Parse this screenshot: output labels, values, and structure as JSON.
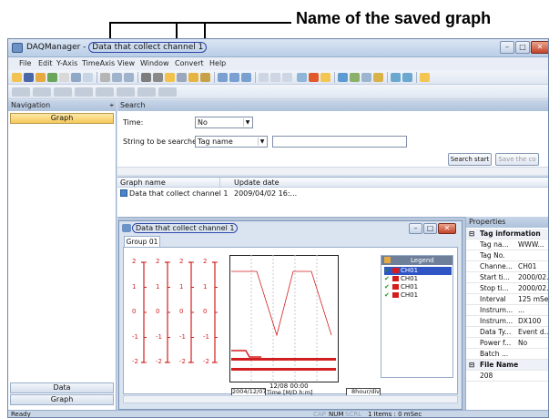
{
  "callout": {
    "saved_graph_label": "Name of the saved graph"
  },
  "window": {
    "app_name": "DAQManager",
    "title_sep": " - ",
    "doc_title": "Data that collect channel 1",
    "controls": {
      "minimize": "–",
      "maximize": "□",
      "close": "✕"
    }
  },
  "menu": [
    "File",
    "Edit",
    "Y-Axis",
    "TimeAxis",
    "View",
    "Window",
    "Convert",
    "Help"
  ],
  "nav": {
    "header": "Navigation",
    "pin": "⌖",
    "selected_item": "Graph",
    "bottom_tabs": [
      "Data",
      "Graph"
    ]
  },
  "search": {
    "header": "Search",
    "time_label": "Time:",
    "time_value": "No",
    "string_label": "String to be searched:",
    "string_field": "Tag name",
    "text_value": "",
    "start_button": "Search start",
    "save_button": "Save the co"
  },
  "results": {
    "columns": [
      "Graph name",
      "Update date"
    ],
    "rows": [
      {
        "name": "Data that collect channel 1",
        "date": "2009/04/02 16:..."
      }
    ]
  },
  "graph_window": {
    "title": "Data that collect channel 1",
    "tab": "Group 01",
    "scale_values": [
      "2",
      "1",
      "0",
      "-1",
      "-2"
    ],
    "time_label": "12/08 00:00",
    "date_field": "2004/12/07",
    "axis_label": "Time [M/D h:m]",
    "div_label": "8hour/div",
    "legend_title": "Legend",
    "legend_items": [
      "CH01",
      "CH01",
      "CH01",
      "CH01"
    ],
    "series_color": "#d21f1f"
  },
  "properties": {
    "header": "Properties",
    "groups": [
      {
        "title": "Tag information",
        "rows": [
          {
            "key": "Tag na...",
            "value": "WWW..."
          },
          {
            "key": "Tag No.",
            "value": ""
          },
          {
            "key": "Channe...",
            "value": "CH01"
          },
          {
            "key": "Start ti...",
            "value": "2000/02..."
          },
          {
            "key": "Stop ti...",
            "value": "2000/02..."
          },
          {
            "key": "Interval",
            "value": "125 mSec"
          },
          {
            "key": "Instrum...",
            "value": "..."
          },
          {
            "key": "Instrum...",
            "value": "DX100"
          },
          {
            "key": "Data Ty...",
            "value": "Event d..."
          },
          {
            "key": "Power f...",
            "value": "No"
          },
          {
            "key": "Batch ...",
            "value": ""
          }
        ]
      },
      {
        "title": "File Name",
        "rows": [
          {
            "key": "208",
            "value": ""
          }
        ]
      }
    ]
  },
  "status": {
    "left": "Ready",
    "caps": "CAP",
    "num": "NUM",
    "scrl": "SCRL",
    "items": "1 Items : 0 mSec"
  }
}
